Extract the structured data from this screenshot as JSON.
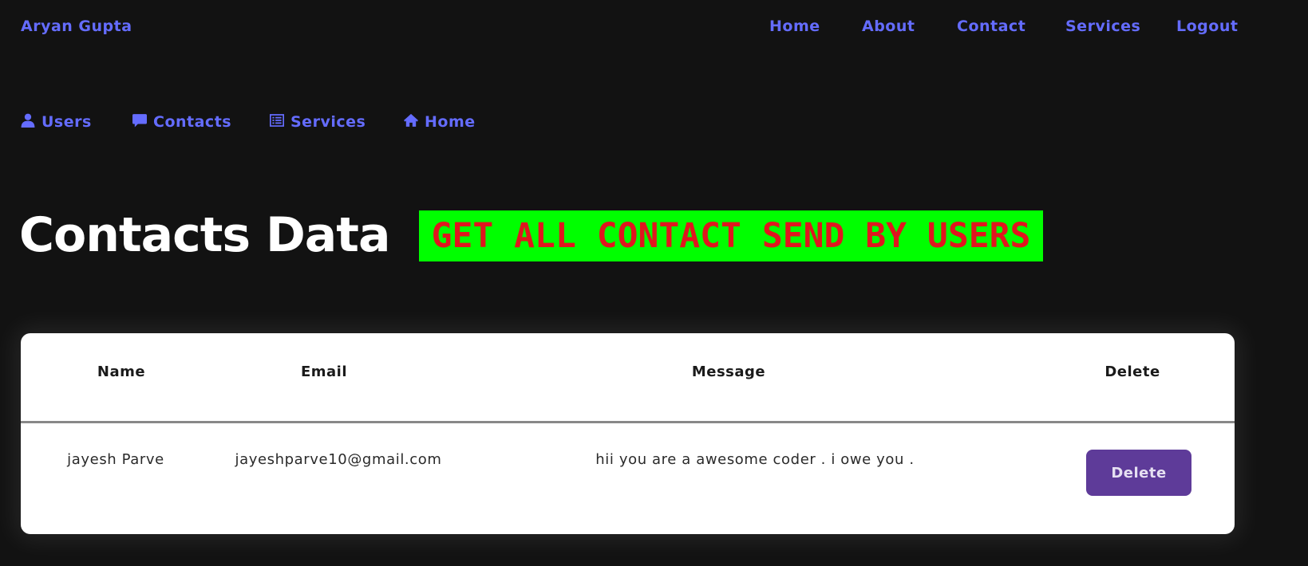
{
  "navbar": {
    "brand": "Aryan Gupta",
    "links": [
      "Home",
      "About",
      "Contact",
      "Services",
      "Logout"
    ]
  },
  "admin_nav": {
    "items": [
      {
        "label": "Users",
        "icon": "user-icon"
      },
      {
        "label": "Contacts",
        "icon": "message-icon"
      },
      {
        "label": "Services",
        "icon": "list-icon"
      },
      {
        "label": "Home",
        "icon": "home-icon"
      }
    ]
  },
  "main": {
    "title": "Contacts Data",
    "banner": "GET ALL CONTACT SEND BY USERS"
  },
  "table": {
    "headers": [
      "Name",
      "Email",
      "Message",
      "Delete"
    ],
    "rows": [
      {
        "name": "jayesh Parve",
        "email": "jayeshparve10@gmail.com",
        "message": "hii you are a awesome coder . i owe you .",
        "delete_label": "Delete"
      }
    ]
  },
  "colors": {
    "background": "#121212",
    "link": "#646cff",
    "banner_bg": "#00ff00",
    "banner_text": "#e0161e",
    "delete_button": "#5e3b99"
  }
}
